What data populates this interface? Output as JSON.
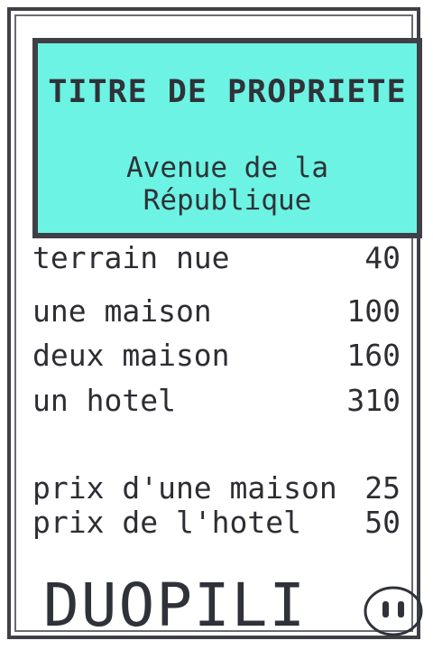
{
  "card": {
    "title": "TITRE DE PROPRIETE",
    "street": "Avenue de la République",
    "rows": [
      {
        "label": "terrain nue",
        "value": "40"
      },
      {
        "label": "une maison",
        "value": "100"
      },
      {
        "label": "deux maison",
        "value": "160"
      },
      {
        "label": "un hotel",
        "value": "310"
      }
    ],
    "extra_rows": [
      {
        "label": "prix d'une maison",
        "value": "25"
      },
      {
        "label": "prix de l'hotel",
        "value": "50"
      }
    ],
    "brand": "DUOPILI",
    "logo_icon": "pig-face-icon",
    "accent_color": "#6cf3e3"
  }
}
